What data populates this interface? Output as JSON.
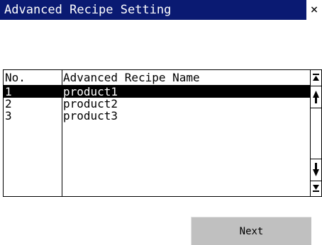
{
  "window": {
    "title": "Advanced Recipe Setting",
    "close_label": "×"
  },
  "list": {
    "headers": {
      "no": "No.",
      "name": "Advanced Recipe Name"
    },
    "rows": [
      {
        "no": "1",
        "name": "product1",
        "selected": true
      },
      {
        "no": "2",
        "name": "product2",
        "selected": false
      },
      {
        "no": "3",
        "name": "product3",
        "selected": false
      }
    ]
  },
  "scrollbar": {
    "icons": [
      "scroll-to-top-icon",
      "scroll-up-icon",
      "scroll-down-icon",
      "scroll-to-bottom-icon"
    ]
  },
  "footer": {
    "next_label": "Next"
  },
  "colors": {
    "titlebar": "#0a1a72",
    "selection": "#000000",
    "button": "#c0c0c0"
  }
}
